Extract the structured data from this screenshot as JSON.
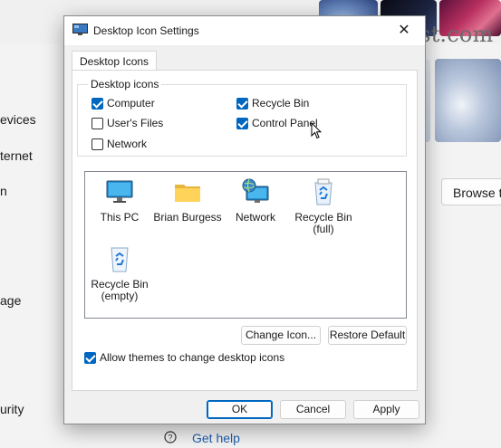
{
  "background": {
    "sidebar": [
      "evices",
      "ternet",
      "n",
      "age",
      "urity"
    ],
    "browse_label": "Browse t",
    "get_help": "Get help",
    "watermark": "groovyPost.com"
  },
  "dialog": {
    "title": "Desktop Icon Settings",
    "tab": "Desktop Icons",
    "group_label": "Desktop icons",
    "checkboxes": [
      {
        "label": "Computer",
        "checked": true
      },
      {
        "label": "Recycle Bin",
        "checked": true
      },
      {
        "label": "User's Files",
        "checked": false
      },
      {
        "label": "Control Panel",
        "checked": true
      },
      {
        "label": "Network",
        "checked": false
      }
    ],
    "icons": [
      {
        "label": "This PC",
        "icon": "monitor-icon"
      },
      {
        "label": "Brian Burgess",
        "icon": "folder-icon"
      },
      {
        "label": "Network",
        "icon": "network-globe-icon"
      },
      {
        "label": "Recycle Bin\n(full)",
        "icon": "recycle-bin-full-icon"
      },
      {
        "label": "Recycle Bin\n(empty)",
        "icon": "recycle-bin-empty-icon"
      }
    ],
    "change_icon": "Change Icon...",
    "restore_default": "Restore Default",
    "allow_themes": "Allow themes to change desktop icons",
    "allow_themes_checked": true,
    "ok": "OK",
    "cancel": "Cancel",
    "apply": "Apply"
  },
  "colors": {
    "accent": "#0067c0",
    "link": "#1f5fb0"
  }
}
